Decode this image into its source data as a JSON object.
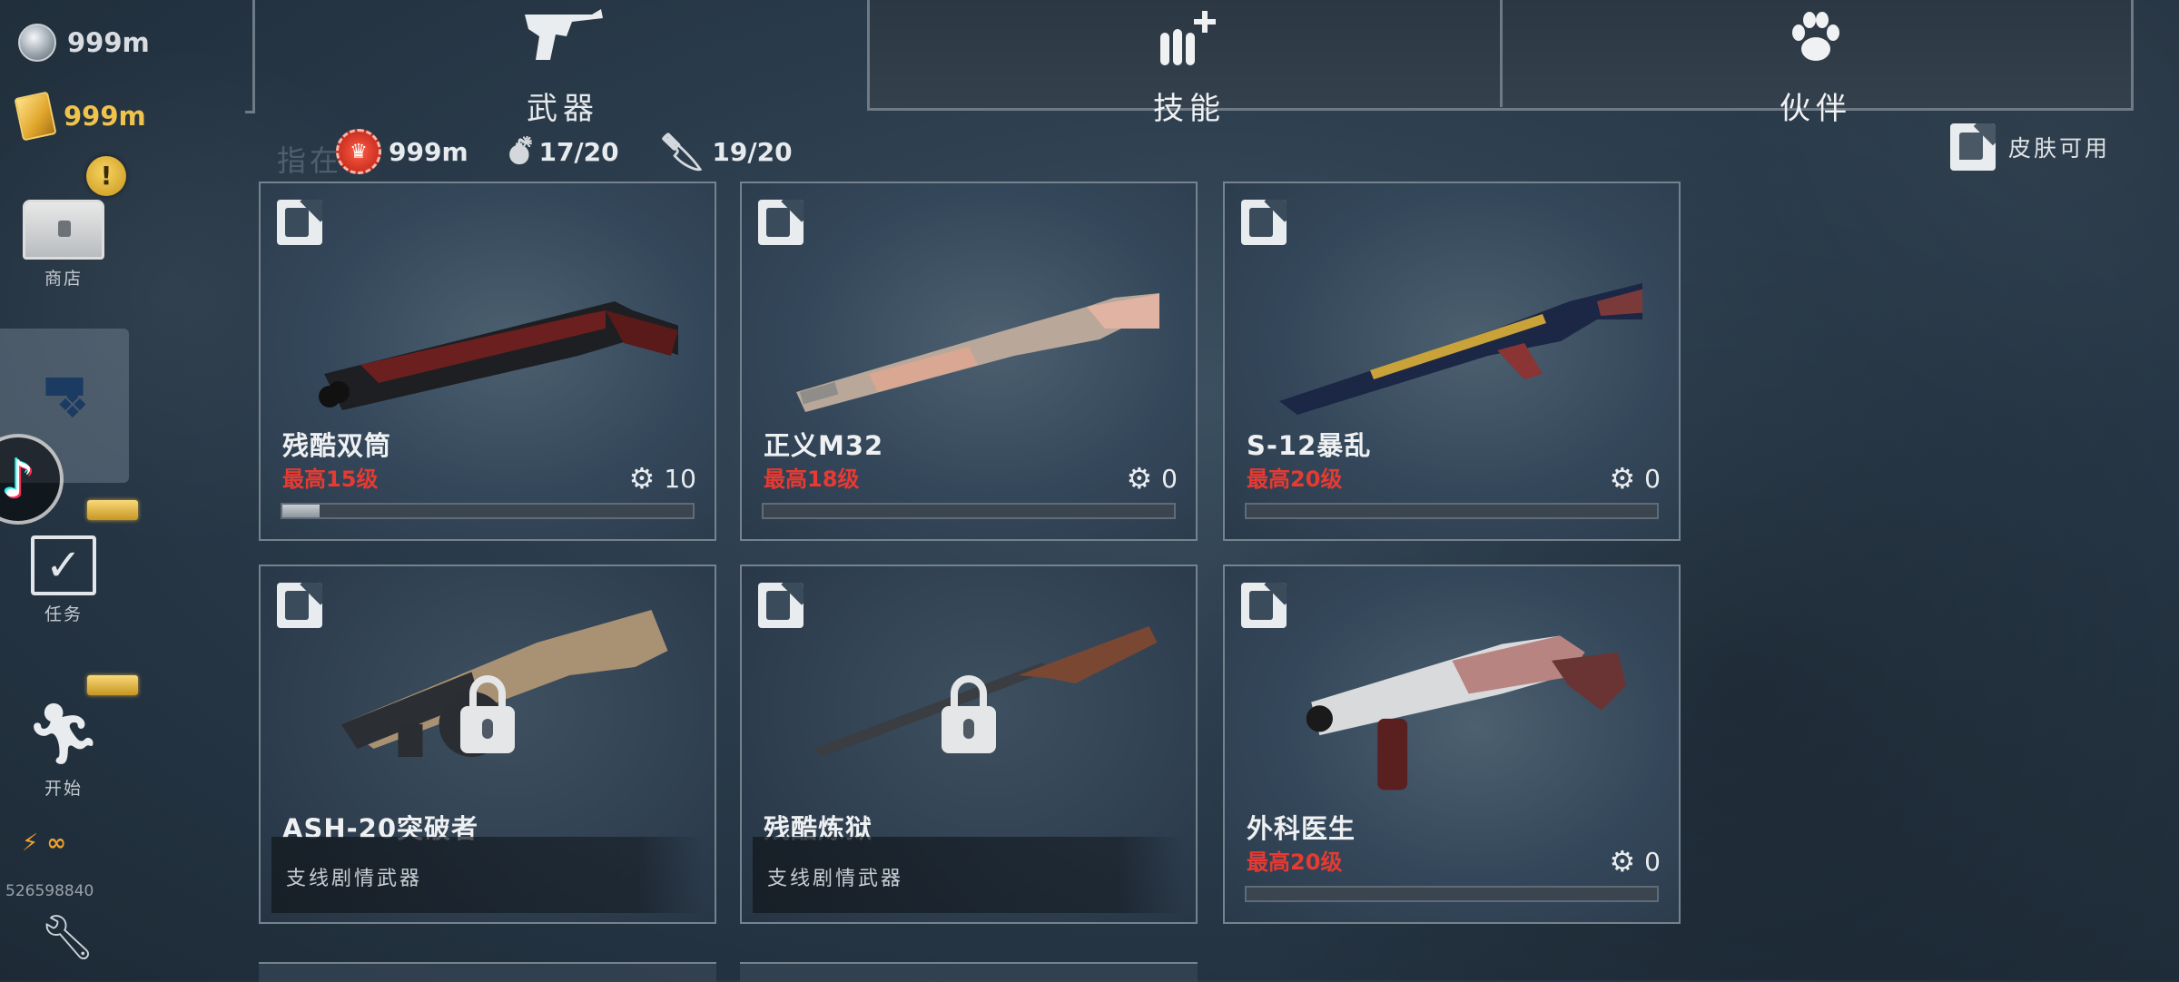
{
  "currencies": {
    "coin": {
      "icon": "silver-coin-icon",
      "value": "999m"
    },
    "gold": {
      "icon": "gold-bar-icon",
      "value": "999m"
    }
  },
  "sidebar": {
    "alert_badge": "!",
    "shop_label": "商店",
    "weapons_icon": "pistol-paw-icon",
    "tasks_label": "任务",
    "start_label": "开始",
    "energy": "∞",
    "user_id": "526598840"
  },
  "tabs": [
    {
      "label": "武器",
      "icon": "revolver-icon",
      "active": true
    },
    {
      "label": "技能",
      "icon": "bullets-plus-icon",
      "active": false
    },
    {
      "label": "伙伴",
      "icon": "paw-icon",
      "active": false
    }
  ],
  "resources": {
    "ghost_text": "指在",
    "bottlecaps": "999m",
    "grenades": "17/20",
    "knives": "19/20"
  },
  "skin_filter_label": "皮肤可用",
  "weapons": [
    {
      "name": "残酷双筒",
      "max_level": "最高15级",
      "parts": "10",
      "progress": 0.09,
      "locked": false
    },
    {
      "name": "正义M32",
      "max_level": "最高18级",
      "parts": "0",
      "progress": 0,
      "locked": false
    },
    {
      "name": "S-12暴乱",
      "max_level": "最高20级",
      "parts": "0",
      "progress": 0,
      "locked": false
    },
    {
      "name": "ASH-20突破者",
      "note": "支线剧情武器",
      "locked": true
    },
    {
      "name": "残酷炼狱",
      "note": "支线剧情武器",
      "locked": true
    },
    {
      "name": "外科医生",
      "max_level": "最高20级",
      "parts": "0",
      "progress": 0,
      "locked": false
    }
  ],
  "colors": {
    "accent_red": "#e63a32",
    "gold": "#f0c34a",
    "frame": "#76838f"
  }
}
